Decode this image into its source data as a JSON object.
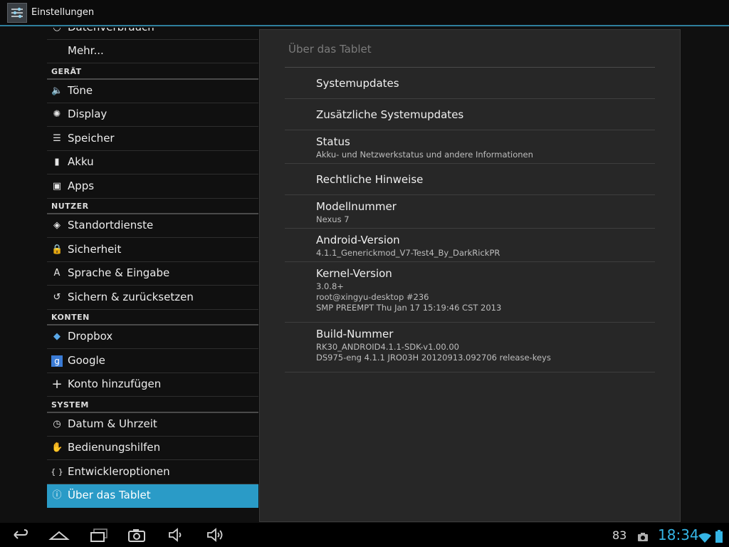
{
  "app": {
    "title": "Einstellungen"
  },
  "left": {
    "partial_item": "Datenverbrauch",
    "items": [
      {
        "label": "Mehr...",
        "icon": "none"
      },
      {
        "header": "GERÄT"
      },
      {
        "label": "Töne",
        "icon": "speaker-icon"
      },
      {
        "label": "Display",
        "icon": "brightness-icon"
      },
      {
        "label": "Speicher",
        "icon": "storage-icon"
      },
      {
        "label": "Akku",
        "icon": "battery-icon"
      },
      {
        "label": "Apps",
        "icon": "apps-icon"
      },
      {
        "header": "NUTZER"
      },
      {
        "label": "Standortdienste",
        "icon": "location-icon"
      },
      {
        "label": "Sicherheit",
        "icon": "lock-icon"
      },
      {
        "label": "Sprache & Eingabe",
        "icon": "keyboard-icon"
      },
      {
        "label": "Sichern & zurücksetzen",
        "icon": "restore-icon"
      },
      {
        "header": "KONTEN"
      },
      {
        "label": "Dropbox",
        "icon": "dropbox-icon"
      },
      {
        "label": "Google",
        "icon": "google-icon"
      },
      {
        "label": "Konto hinzufügen",
        "icon": "plus-icon"
      },
      {
        "header": "SYSTEM"
      },
      {
        "label": "Datum & Uhrzeit",
        "icon": "clock-icon"
      },
      {
        "label": "Bedienungshilfen",
        "icon": "hand-icon"
      },
      {
        "label": "Entwickleroptionen",
        "icon": "braces-icon"
      },
      {
        "label": "Über das Tablet",
        "icon": "info-icon",
        "selected": true
      }
    ]
  },
  "detail": {
    "title": "Über das Tablet",
    "items": [
      {
        "title": "Systemupdates",
        "sub": []
      },
      {
        "title": "Zusätzliche Systemupdates",
        "sub": []
      },
      {
        "title": "Status",
        "sub": [
          "Akku- und Netzwerkstatus und andere Informationen"
        ]
      },
      {
        "title": "Rechtliche Hinweise",
        "sub": []
      },
      {
        "title": "Modellnummer",
        "sub": [
          "Nexus 7"
        ]
      },
      {
        "title": "Android-Version",
        "sub": [
          "4.1.1_Generickmod_V7-Test4_By_DarkRickPR"
        ]
      },
      {
        "title": "Kernel-Version",
        "sub": [
          "3.0.8+",
          "root@xingyu-desktop #236",
          "SMP PREEMPT Thu Jan 17 15:19:46 CST 2013"
        ]
      },
      {
        "title": "Build-Nummer",
        "sub": [
          "RK30_ANDROID4.1.1-SDK-v1.00.00",
          "DS975-eng 4.1.1 JRO03H 20120913.092706 release-keys"
        ]
      }
    ]
  },
  "navbar": {
    "buttons": [
      "back-icon",
      "home-icon",
      "recent-apps-icon",
      "camera-icon",
      "volume-down-icon",
      "volume-up-icon"
    ],
    "status_count": "83",
    "time": "18:34"
  },
  "colors": {
    "accent": "#2a9bc7",
    "clock": "#35b5e5",
    "selection": "#2a9bc7"
  }
}
